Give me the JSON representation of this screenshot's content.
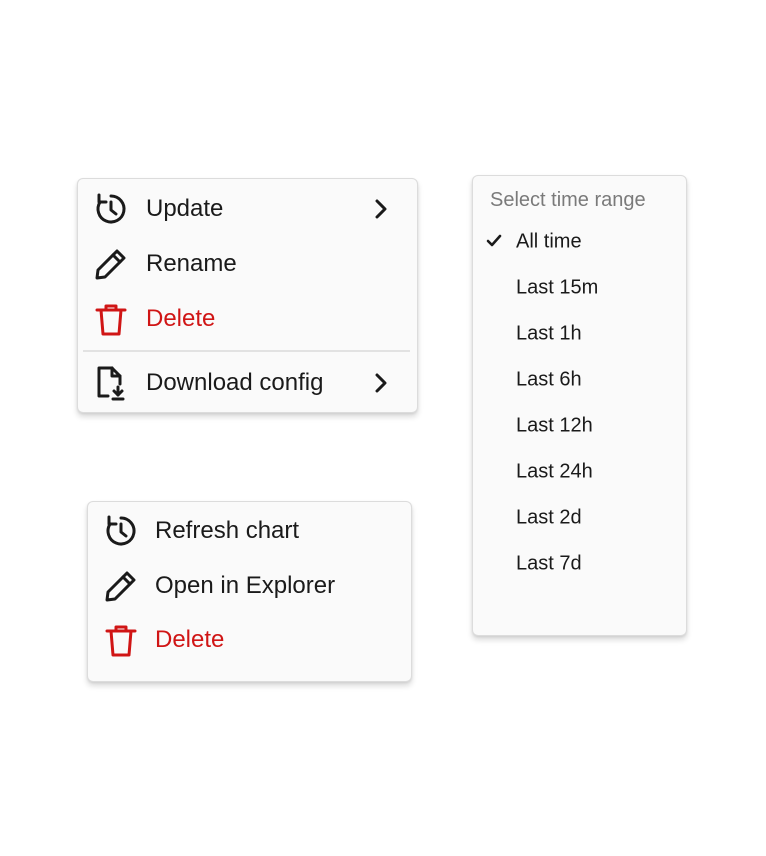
{
  "colors": {
    "danger": "#d01515",
    "text": "#1a1a1a",
    "muted": "#7a7a7a"
  },
  "dashboard_menu": {
    "items": [
      {
        "label": "Update",
        "icon": "refresh-clock-icon",
        "has_submenu": true
      },
      {
        "label": "Rename",
        "icon": "pencil-icon",
        "has_submenu": false
      },
      {
        "label": "Delete",
        "icon": "trash-icon",
        "has_submenu": false,
        "danger": true
      },
      {
        "label": "Download config",
        "icon": "file-download-icon",
        "has_submenu": true
      }
    ]
  },
  "chart_menu": {
    "items": [
      {
        "label": "Refresh chart",
        "icon": "refresh-clock-icon"
      },
      {
        "label": "Open in Explorer",
        "icon": "pencil-icon"
      },
      {
        "label": "Delete",
        "icon": "trash-icon",
        "danger": true
      }
    ]
  },
  "time_range": {
    "header": "Select time range",
    "selected": "All time",
    "options": [
      "All time",
      "Last 15m",
      "Last 1h",
      "Last 6h",
      "Last 12h",
      "Last 24h",
      "Last 2d",
      "Last 7d"
    ]
  }
}
